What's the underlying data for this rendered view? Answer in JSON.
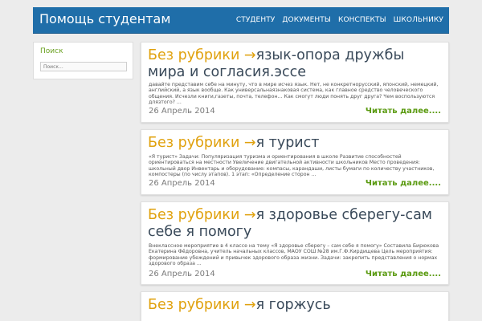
{
  "header": {
    "site_title": "Помощь студентам",
    "nav": [
      "СТУДЕНТУ",
      "ДОКУМЕНТЫ",
      "КОНСПЕКТЫ",
      "ШКОЛЬНИКУ"
    ]
  },
  "sidebar": {
    "search_title": "Поиск",
    "search_placeholder": "Поиск..."
  },
  "colors": {
    "header_bg": "#1f6ea9",
    "category": "#e0a10d",
    "readmore": "#5a9a10",
    "sidebar_title": "#6aa121"
  },
  "posts": [
    {
      "category": "Без рубрики →",
      "title": "язык-опора дружбы мира и согласия.эссе",
      "excerpt": "давайте представим себе на минуту, что в мире исчез язык. Нет, не конкретнорусский, японский, немецкий, английский, а язык вообще. Как универсальнаязнаковая система, как главное средство человеческого общения. Исчезли книги,газеты, почта, телефон… Как смогут люди понять друг друга? Чем воспользуются длязтого? ...",
      "date": "26 Апрель 2014",
      "readmore": "Читать далее...."
    },
    {
      "category": "Без рубрики →",
      "title": "я турист",
      "excerpt": "«Я турист» Задачи: Популяризация туризма и ориентирования в школе Развитие способностей ориентироваться на местности Увеличение двигательной активности школьников Место проведения: школьный двор Инвентарь и оборудование: компасы, карандаши, листы бумаги по количеству участников, компостеры (по числу этапов). 1 этап: «Определение сторон ...",
      "date": "26 Апрель 2014",
      "readmore": "Читать далее...."
    },
    {
      "category": "Без рубрики →",
      "title": "я здоровье сберегу-сам себе я помогу",
      "excerpt": "Внеклассное мероприятие в 4 классе на тему «Я здоровье сберегу – сам себе я помогу» Составила Бирюкова Екатерина Фёдоровна, учитель начальных классов, МАОУ СОШ №28 им.Г.Ф.Кирдищева Цель мероприятия: формирование убеждений и привычек здорового образа жизни. Задачи: закрепить представления о нормах здорового образа ...",
      "date": "26 Апрель 2014",
      "readmore": "Читать далее...."
    },
    {
      "category": "Без рубрики →",
      "title": "я горжусь",
      "excerpt": "",
      "date": "",
      "readmore": ""
    }
  ]
}
